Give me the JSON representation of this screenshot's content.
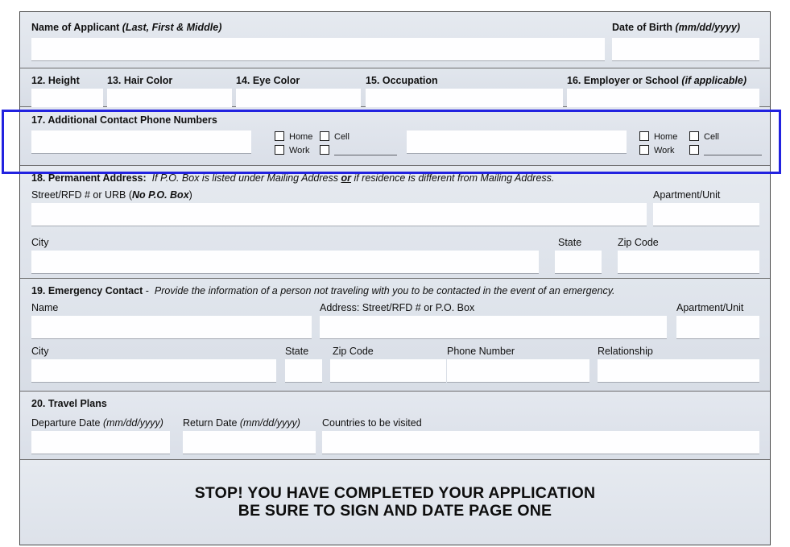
{
  "form": {
    "applicant": {
      "name_label": "Name of Applicant",
      "name_hint": "(Last, First & Middle)",
      "dob_label": "Date of Birth",
      "dob_hint": "(mm/dd/yyyy)"
    },
    "physical": {
      "height_label": "12. Height",
      "hair_label": "13. Hair Color",
      "eye_label": "14. Eye Color",
      "occupation_label": "15. Occupation",
      "employer_label": "16. Employer or School",
      "employer_hint": "(if applicable)"
    },
    "section17": {
      "title": "17. Additional Contact Phone Numbers",
      "checkbox_home": "Home",
      "checkbox_cell": "Cell",
      "checkbox_work": "Work",
      "checkbox_other": ""
    },
    "section18": {
      "title": "18. Permanent Address:",
      "instruction_pre": "If P.O. Box is listed under Mailing Address ",
      "instruction_or": "or",
      "instruction_post": " if residence is different from Mailing Address.",
      "street_label_pre": "Street/RFD # or URB (",
      "street_label_bold": "No P.O. Box",
      "street_label_post": ")",
      "apartment_label": "Apartment/Unit",
      "city_label": "City",
      "state_label": "State",
      "zip_label": "Zip Code"
    },
    "section19": {
      "title": "19. Emergency Contact",
      "title_dash": "-",
      "instruction": "Provide the information of a person not traveling with you to be contacted in the event of an emergency.",
      "name_label": "Name",
      "address_label": "Address: Street/RFD # or P.O. Box",
      "apartment_label": "Apartment/Unit",
      "city_label": "City",
      "state_label": "State",
      "zip_label": "Zip Code",
      "phone_label": "Phone Number",
      "relationship_label": "Relationship"
    },
    "section20": {
      "title": "20. Travel Plans",
      "departure_label": "Departure Date",
      "departure_hint": "(mm/dd/yyyy)",
      "return_label": "Return Date",
      "return_hint": "(mm/dd/yyyy)",
      "countries_label": "Countries to be visited"
    },
    "stop_notice": {
      "line1": "STOP! YOU HAVE COMPLETED YOUR APPLICATION",
      "line2": "BE SURE TO SIGN AND DATE PAGE ONE"
    }
  },
  "annotation": {
    "highlight_color": "#2222e0",
    "highlight_target": "17. Additional Contact Phone Numbers"
  }
}
